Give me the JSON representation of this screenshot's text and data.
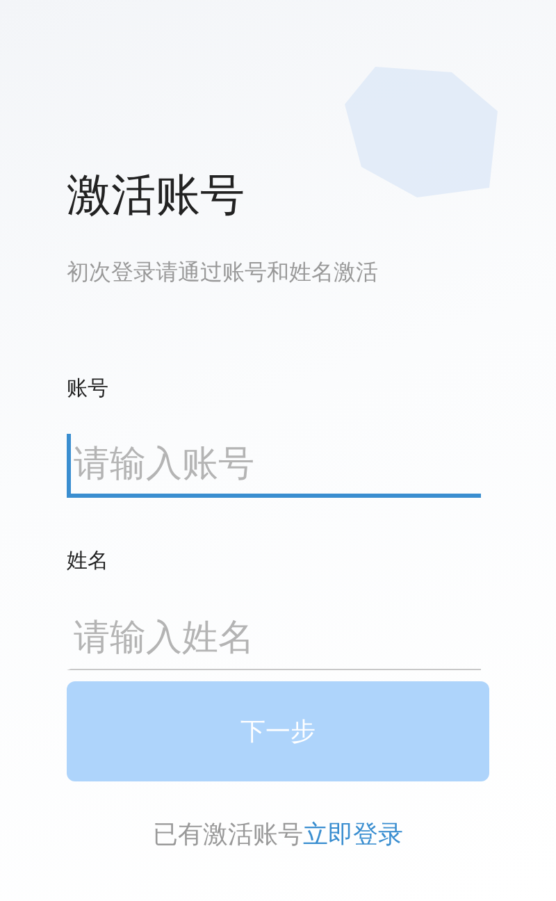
{
  "title": "激活账号",
  "subtitle": "初次登录请通过账号和姓名激活",
  "fields": [
    {
      "label": "账号",
      "placeholder": "请输入账号",
      "focused": true
    },
    {
      "label": "姓名",
      "placeholder": "请输入姓名",
      "focused": false
    }
  ],
  "next_button": {
    "label": "下一步",
    "disabled": true
  },
  "footer": {
    "text": "已有激活账号",
    "link": "立即登录"
  }
}
